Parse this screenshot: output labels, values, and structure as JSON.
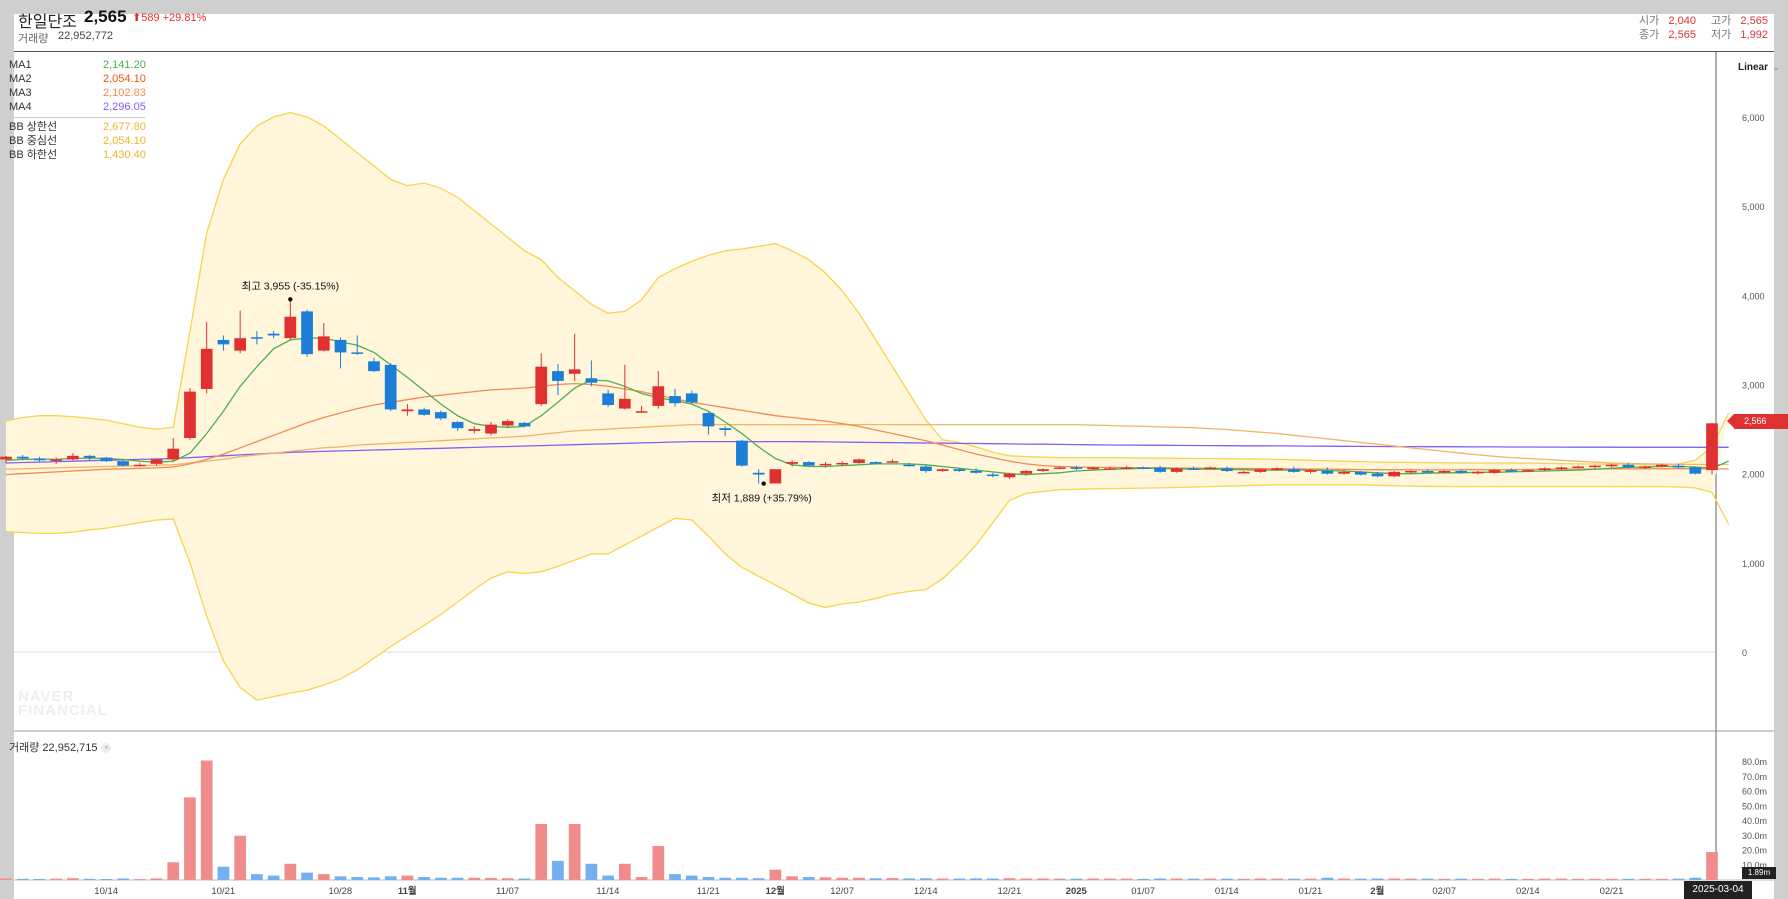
{
  "header": {
    "name": "한일단조",
    "price": "2,565",
    "change": "⬆589 +29.81%",
    "volume_label": "거래량",
    "volume_value": "22,952,772",
    "ohlc": {
      "open_label": "시가",
      "open": "2,040",
      "high_label": "고가",
      "high": "2,565",
      "close_label": "종가",
      "close": "2,565",
      "low_label": "저가",
      "low": "1,992"
    }
  },
  "legend": [
    {
      "name": "MA1",
      "value": "2,141.20",
      "color": "#4caf50"
    },
    {
      "name": "MA2",
      "value": "2,054.10",
      "color": "#e8590c"
    },
    {
      "name": "MA3",
      "value": "2,102.83",
      "color": "#f08c50"
    },
    {
      "name": "MA4",
      "value": "2,296.05",
      "color": "#845ef7"
    }
  ],
  "bb_legend": [
    {
      "name": "BB 상한선",
      "value": "2,677.80",
      "color": "#f0b429"
    },
    {
      "name": "BB 중심선",
      "value": "2,054.10",
      "color": "#f0b429"
    },
    {
      "name": "BB 하한선",
      "value": "1,430.40",
      "color": "#f0b429"
    }
  ],
  "scale_mode": "Linear",
  "volume_legend": "거래량 22,952,715",
  "watermark": [
    "NAVER",
    "FINANCIAL"
  ],
  "annotations": {
    "high": "최고 3,955 (-35.15%)",
    "low": "최저 1,889 (+35.79%)"
  },
  "current_price_tag": "2,566",
  "current_volume_tag": "1.89m",
  "current_date_tag": "2025-03-04",
  "colors": {
    "up": "#e03131",
    "down": "#1c7ed6",
    "up_volume": "#f08c8c",
    "down_volume": "#74b0ef",
    "band_fill": "#fff6dc",
    "band_line": "#f7d44c"
  },
  "chart_data": {
    "type": "candlestick",
    "x_labels": [
      "10/14",
      "10/21",
      "10/28",
      "11월",
      "11/07",
      "11/14",
      "11/21",
      "12월",
      "12/07",
      "12/14",
      "12/21",
      "2025",
      "01/07",
      "01/14",
      "01/21",
      "2월",
      "02/07",
      "02/14",
      "02/21"
    ],
    "y_ticks": [
      "0",
      "1,000",
      "2,000",
      "3,000",
      "4,000",
      "5,000",
      "6,000"
    ],
    "ylim": [
      0,
      6300
    ],
    "volume_ticks": [
      "10.0m",
      "20.0m",
      "30.0m",
      "40.0m",
      "50.0m",
      "60.0m",
      "70.0m",
      "80.0m"
    ],
    "volume_ylim": [
      0,
      85
    ],
    "candles": [
      [
        2160,
        2200,
        2120,
        2190,
        1.0
      ],
      [
        2190,
        2210,
        2150,
        2170,
        0.8
      ],
      [
        2170,
        2190,
        2130,
        2150,
        0.7
      ],
      [
        2150,
        2180,
        2110,
        2160,
        0.9
      ],
      [
        2160,
        2230,
        2150,
        2200,
        1.2
      ],
      [
        2200,
        2210,
        2150,
        2180,
        0.8
      ],
      [
        2180,
        2190,
        2130,
        2140,
        0.7
      ],
      [
        2140,
        2150,
        2080,
        2090,
        1.0
      ],
      [
        2090,
        2120,
        2080,
        2100,
        0.6
      ],
      [
        2110,
        2170,
        2090,
        2160,
        1.1
      ],
      [
        2160,
        2400,
        2140,
        2280,
        12.0
      ],
      [
        2400,
        2960,
        2380,
        2920,
        56.0
      ],
      [
        2950,
        3700,
        2900,
        3400,
        81.0
      ],
      [
        3500,
        3550,
        3380,
        3450,
        9.0
      ],
      [
        3380,
        3830,
        3350,
        3520,
        30.0
      ],
      [
        3530,
        3600,
        3450,
        3520,
        4.0
      ],
      [
        3570,
        3600,
        3520,
        3550,
        3.0
      ],
      [
        3520,
        3955,
        3500,
        3760,
        11.0
      ],
      [
        3820,
        3840,
        3310,
        3340,
        5.0
      ],
      [
        3380,
        3690,
        3370,
        3540,
        4.0
      ],
      [
        3500,
        3530,
        3180,
        3360,
        2.5
      ],
      [
        3360,
        3550,
        3330,
        3350,
        2.0
      ],
      [
        3260,
        3300,
        3140,
        3150,
        1.8
      ],
      [
        3220,
        3240,
        2700,
        2720,
        2.5
      ],
      [
        2700,
        2780,
        2650,
        2720,
        3.0
      ],
      [
        2720,
        2740,
        2650,
        2660,
        2.0
      ],
      [
        2690,
        2710,
        2600,
        2620,
        1.5
      ],
      [
        2580,
        2590,
        2480,
        2510,
        1.5
      ],
      [
        2480,
        2530,
        2450,
        2500,
        1.5
      ],
      [
        2450,
        2580,
        2430,
        2550,
        1.4
      ],
      [
        2540,
        2610,
        2510,
        2590,
        1.2
      ],
      [
        2570,
        2580,
        2520,
        2530,
        1.0
      ],
      [
        2780,
        3350,
        2760,
        3200,
        38.0
      ],
      [
        3150,
        3230,
        2880,
        3040,
        13.0
      ],
      [
        3120,
        3570,
        3040,
        3170,
        38.0
      ],
      [
        3070,
        3270,
        2980,
        3020,
        11.0
      ],
      [
        2900,
        2940,
        2750,
        2770,
        3.0
      ],
      [
        2730,
        3220,
        2720,
        2840,
        11.0
      ],
      [
        2700,
        2760,
        2680,
        2700,
        2.0
      ],
      [
        2760,
        3150,
        2730,
        2980,
        23.0
      ],
      [
        2870,
        2950,
        2750,
        2790,
        4.0
      ],
      [
        2900,
        2930,
        2780,
        2800,
        3.0
      ],
      [
        2680,
        2700,
        2440,
        2530,
        2.0
      ],
      [
        2510,
        2530,
        2420,
        2490,
        1.5
      ],
      [
        2370,
        2380,
        2080,
        2090,
        1.5
      ],
      [
        2010,
        2050,
        1889,
        1990,
        1.2
      ],
      [
        1890,
        2050,
        1889,
        2050,
        7.0
      ],
      [
        2110,
        2150,
        2080,
        2130,
        2.5
      ],
      [
        2130,
        2140,
        2080,
        2090,
        2.0
      ],
      [
        2100,
        2130,
        2070,
        2110,
        1.8
      ],
      [
        2110,
        2140,
        2090,
        2120,
        1.5
      ],
      [
        2120,
        2170,
        2110,
        2160,
        1.5
      ],
      [
        2130,
        2140,
        2110,
        2120,
        1.2
      ],
      [
        2130,
        2160,
        2120,
        2140,
        1.3
      ],
      [
        2100,
        2120,
        2080,
        2090,
        1.1
      ],
      [
        2080,
        2100,
        2010,
        2030,
        1.2
      ],
      [
        2030,
        2060,
        2020,
        2050,
        1.0
      ],
      [
        2050,
        2060,
        2020,
        2030,
        1.0
      ],
      [
        2030,
        2060,
        2000,
        2010,
        1.1
      ],
      [
        1990,
        2010,
        1960,
        1980,
        1.0
      ],
      [
        1960,
        2010,
        1940,
        2000,
        1.2
      ],
      [
        2000,
        2040,
        1980,
        2030,
        1.0
      ],
      [
        2030,
        2060,
        2020,
        2050,
        1.0
      ],
      [
        2060,
        2080,
        2050,
        2070,
        0.9
      ],
      [
        2070,
        2090,
        2040,
        2060,
        0.9
      ],
      [
        2050,
        2080,
        2040,
        2070,
        1.0
      ],
      [
        2060,
        2080,
        2050,
        2060,
        0.9
      ],
      [
        2060,
        2090,
        2050,
        2070,
        0.9
      ],
      [
        2070,
        2080,
        2050,
        2060,
        0.8
      ],
      [
        2070,
        2090,
        2010,
        2020,
        1.0
      ],
      [
        2020,
        2070,
        2010,
        2060,
        1.0
      ],
      [
        2060,
        2080,
        2040,
        2050,
        0.9
      ],
      [
        2060,
        2080,
        2050,
        2070,
        0.9
      ],
      [
        2060,
        2080,
        2020,
        2030,
        0.9
      ],
      [
        2020,
        2030,
        2000,
        2020,
        0.8
      ],
      [
        2020,
        2060,
        2010,
        2050,
        1.0
      ],
      [
        2040,
        2070,
        2030,
        2060,
        0.9
      ],
      [
        2050,
        2080,
        2010,
        2020,
        0.9
      ],
      [
        2020,
        2050,
        2000,
        2040,
        0.9
      ],
      [
        2030,
        2070,
        1990,
        2000,
        1.5
      ],
      [
        2000,
        2040,
        1990,
        2020,
        1.0
      ],
      [
        2020,
        2030,
        1980,
        1990,
        0.9
      ],
      [
        2000,
        2020,
        1960,
        1970,
        1.0
      ],
      [
        1970,
        2030,
        1960,
        2020,
        1.0
      ],
      [
        2020,
        2040,
        2000,
        2030,
        0.9
      ],
      [
        2030,
        2050,
        2010,
        2020,
        0.9
      ],
      [
        2020,
        2040,
        2000,
        2030,
        0.8
      ],
      [
        2030,
        2050,
        2000,
        2010,
        0.9
      ],
      [
        2010,
        2030,
        1990,
        2020,
        0.8
      ],
      [
        2010,
        2050,
        2000,
        2040,
        0.9
      ],
      [
        2040,
        2060,
        2020,
        2030,
        0.8
      ],
      [
        2030,
        2050,
        2020,
        2040,
        0.8
      ],
      [
        2040,
        2070,
        2030,
        2060,
        0.9
      ],
      [
        2060,
        2080,
        2040,
        2070,
        0.9
      ],
      [
        2070,
        2090,
        2060,
        2080,
        0.8
      ],
      [
        2080,
        2100,
        2060,
        2090,
        0.8
      ],
      [
        2090,
        2110,
        2070,
        2100,
        0.8
      ],
      [
        2100,
        2120,
        2060,
        2070,
        0.8
      ],
      [
        2070,
        2090,
        2050,
        2080,
        0.8
      ],
      [
        2080,
        2110,
        2070,
        2100,
        0.8
      ],
      [
        2090,
        2110,
        2060,
        2070,
        0.9
      ],
      [
        2070,
        2080,
        1992,
        2000,
        1.5
      ],
      [
        2040,
        2565,
        1992,
        2565,
        19.0
      ]
    ],
    "ma1": [
      2150,
      2160,
      2165,
      2160,
      2170,
      2175,
      2170,
      2160,
      2140,
      2130,
      2140,
      2230,
      2450,
      2700,
      2980,
      3200,
      3400,
      3500,
      3520,
      3520,
      3480,
      3440,
      3360,
      3220,
      3080,
      2930,
      2780,
      2650,
      2560,
      2530,
      2520,
      2530,
      2650,
      2800,
      2960,
      3050,
      3040,
      2980,
      2900,
      2850,
      2820,
      2780,
      2700,
      2580,
      2450,
      2300,
      2170,
      2100,
      2080,
      2080,
      2090,
      2100,
      2110,
      2110,
      2110,
      2100,
      2080,
      2060,
      2040,
      2020,
      2000,
      1990,
      2000,
      2010,
      2030,
      2040,
      2050,
      2055,
      2060,
      2060,
      2055,
      2050,
      2050,
      2050,
      2045,
      2040,
      2040,
      2040,
      2040,
      2035,
      2030,
      2020,
      2010,
      2000,
      2000,
      2005,
      2010,
      2010,
      2015,
      2015,
      2020,
      2025,
      2030,
      2035,
      2040,
      2050,
      2060,
      2070,
      2075,
      2080,
      2080,
      2075,
      2060,
      2141
    ],
    "ma2": [
      1990,
      2000,
      2010,
      2020,
      2030,
      2040,
      2050,
      2055,
      2060,
      2065,
      2075,
      2110,
      2160,
      2220,
      2290,
      2360,
      2430,
      2500,
      2570,
      2630,
      2680,
      2730,
      2770,
      2800,
      2830,
      2860,
      2880,
      2900,
      2920,
      2940,
      2950,
      2960,
      2980,
      3000,
      3010,
      3000,
      2980,
      2950,
      2920,
      2880,
      2840,
      2800,
      2770,
      2740,
      2710,
      2680,
      2650,
      2630,
      2610,
      2590,
      2560,
      2530,
      2490,
      2450,
      2410,
      2370,
      2320,
      2270,
      2220,
      2180,
      2140,
      2110,
      2090,
      2080,
      2075,
      2070,
      2070,
      2068,
      2066,
      2065,
      2063,
      2062,
      2060,
      2060,
      2058,
      2056,
      2055,
      2054,
      2052,
      2050,
      2048,
      2046,
      2045,
      2044,
      2043,
      2042,
      2042,
      2043,
      2044,
      2045,
      2046,
      2047,
      2048,
      2050,
      2051,
      2052,
      2053,
      2054,
      2055,
      2056,
      2056,
      2055,
      2054,
      2054
    ],
    "ma3": [
      2050,
      2055,
      2060,
      2065,
      2070,
      2075,
      2080,
      2085,
      2090,
      2095,
      2100,
      2120,
      2140,
      2160,
      2190,
      2210,
      2230,
      2250,
      2270,
      2290,
      2300,
      2320,
      2330,
      2340,
      2350,
      2360,
      2370,
      2380,
      2390,
      2400,
      2410,
      2420,
      2440,
      2460,
      2480,
      2490,
      2500,
      2510,
      2520,
      2530,
      2540,
      2550,
      2550,
      2550,
      2550,
      2550,
      2550,
      2550,
      2550,
      2550,
      2550,
      2550,
      2550,
      2550,
      2550,
      2550,
      2550,
      2550,
      2550,
      2550,
      2550,
      2550,
      2550,
      2550,
      2550,
      2545,
      2540,
      2535,
      2530,
      2525,
      2520,
      2515,
      2505,
      2495,
      2480,
      2465,
      2450,
      2430,
      2410,
      2390,
      2370,
      2350,
      2330,
      2310,
      2290,
      2270,
      2250,
      2230,
      2210,
      2195,
      2180,
      2170,
      2160,
      2150,
      2140,
      2130,
      2120,
      2115,
      2110,
      2108,
      2105,
      2104,
      2103,
      2103
    ],
    "ma4": [
      2120,
      2125,
      2130,
      2135,
      2140,
      2145,
      2150,
      2155,
      2160,
      2165,
      2170,
      2180,
      2190,
      2200,
      2210,
      2220,
      2230,
      2240,
      2245,
      2250,
      2255,
      2260,
      2265,
      2270,
      2275,
      2280,
      2285,
      2290,
      2295,
      2300,
      2305,
      2310,
      2315,
      2320,
      2325,
      2330,
      2335,
      2340,
      2345,
      2350,
      2355,
      2360,
      2360,
      2360,
      2360,
      2360,
      2360,
      2360,
      2358,
      2356,
      2354,
      2352,
      2350,
      2348,
      2346,
      2344,
      2342,
      2340,
      2338,
      2336,
      2334,
      2332,
      2330,
      2328,
      2326,
      2324,
      2322,
      2320,
      2319,
      2318,
      2317,
      2316,
      2315,
      2314,
      2313,
      2312,
      2311,
      2310,
      2309,
      2308,
      2307,
      2306,
      2305,
      2304,
      2303,
      2302,
      2302,
      2301,
      2300,
      2300,
      2299,
      2299,
      2298,
      2298,
      2297,
      2297,
      2297,
      2296,
      2296,
      2296,
      2296,
      2296,
      2296,
      2296
    ],
    "bb_upper": [
      2590,
      2630,
      2650,
      2650,
      2640,
      2620,
      2600,
      2560,
      2520,
      2500,
      2520,
      3600,
      4700,
      5300,
      5700,
      5900,
      6000,
      6050,
      6000,
      5900,
      5750,
      5600,
      5450,
      5300,
      5230,
      5260,
      5200,
      5100,
      4950,
      4800,
      4650,
      4500,
      4400,
      4200,
      4050,
      3900,
      3800,
      3820,
      3950,
      4200,
      4300,
      4380,
      4450,
      4500,
      4520,
      4550,
      4580,
      4500,
      4400,
      4250,
      4050,
      3800,
      3500,
      3200,
      2900,
      2600,
      2380,
      2350,
      2300,
      2240,
      2200,
      2190,
      2185,
      2180,
      2180,
      2180,
      2180,
      2178,
      2176,
      2174,
      2172,
      2170,
      2170,
      2168,
      2166,
      2164,
      2160,
      2155,
      2150,
      2145,
      2140,
      2135,
      2130,
      2128,
      2126,
      2124,
      2122,
      2120,
      2120,
      2120,
      2120,
      2118,
      2115,
      2112,
      2110,
      2108,
      2106,
      2104,
      2102,
      2100,
      2110,
      2150,
      2300,
      2678
    ],
    "bb_lower": [
      1350,
      1340,
      1330,
      1330,
      1345,
      1370,
      1390,
      1420,
      1450,
      1480,
      1490,
      1000,
      400,
      -100,
      -400,
      -540,
      -500,
      -460,
      -430,
      -370,
      -300,
      -200,
      -70,
      60,
      180,
      300,
      420,
      560,
      700,
      830,
      900,
      880,
      900,
      960,
      1030,
      1100,
      1100,
      1200,
      1300,
      1400,
      1500,
      1480,
      1300,
      1100,
      950,
      850,
      750,
      650,
      550,
      500,
      540,
      560,
      600,
      650,
      680,
      700,
      820,
      1000,
      1200,
      1450,
      1700,
      1780,
      1800,
      1820,
      1825,
      1830,
      1832,
      1835,
      1838,
      1840,
      1845,
      1850,
      1855,
      1860,
      1865,
      1870,
      1875,
      1875,
      1875,
      1875,
      1875,
      1875,
      1870,
      1865,
      1860,
      1858,
      1856,
      1855,
      1855,
      1855,
      1855,
      1855,
      1855,
      1855,
      1855,
      1855,
      1855,
      1855,
      1855,
      1855,
      1850,
      1840,
      1790,
      1430
    ]
  }
}
